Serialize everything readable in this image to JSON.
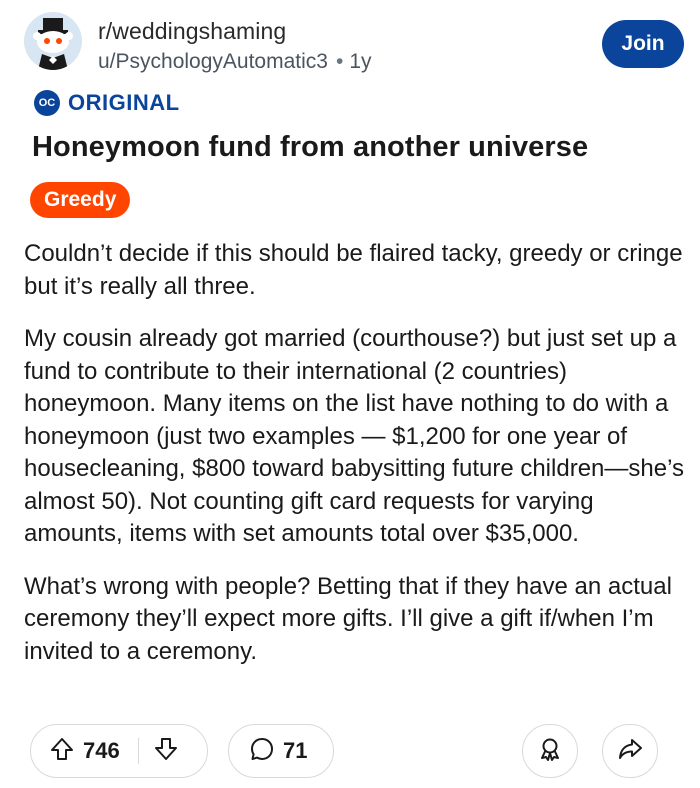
{
  "post": {
    "subreddit": "r/weddingshaming",
    "author": "u/PsychologyAutomatic3",
    "separator": "•",
    "age": "1y",
    "join_label": "Join",
    "oc_badge": "OC",
    "oc_label": "ORIGINAL",
    "title": "Honeymoon fund from another universe",
    "flair": "Greedy",
    "paragraphs": [
      "Couldn’t decide if this should be flaired tacky, greedy or cringe but it’s really all three.",
      "My cousin already got married (courthouse?) but just set up a fund to contribute to their international (2 countries) honeymoon. Many items on the list have nothing to do with a honeymoon (just two examples — $1,200 for one year of housecleaning, $800 toward babysitting future children—she’s almost 50). Not counting gift card requests for varying amounts, items with set amounts total over $35,000.",
      "What’s wrong with people? Betting that if they have an actual ceremony they’ll expect more gifts. I’ll give a gift if/when I’m invited to a ceremony."
    ],
    "score": "746",
    "comments": "71"
  },
  "icons": {
    "avatar": "subreddit-avatar-icon",
    "upvote": "upvote-arrow-icon",
    "downvote": "downvote-arrow-icon",
    "comment": "comment-bubble-icon",
    "award": "award-icon",
    "share": "share-arrow-icon"
  },
  "colors": {
    "join_bg": "#0a449b",
    "flair_bg": "#ff4500",
    "oc_color": "#0a449b",
    "border": "#d6dadd"
  }
}
